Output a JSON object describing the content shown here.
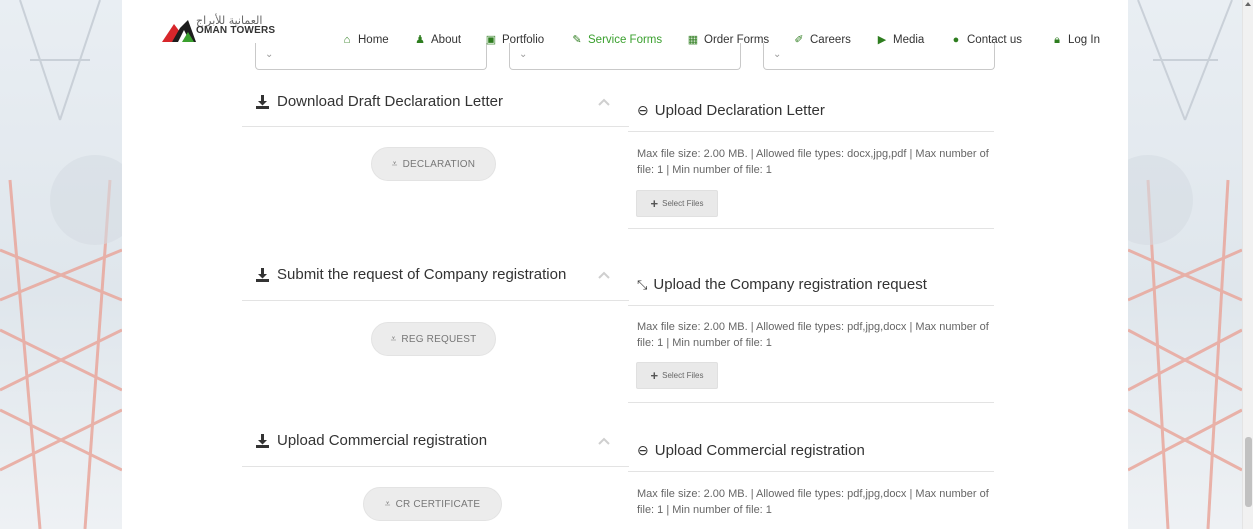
{
  "header": {
    "logo_ar": "العمانية للأبراج",
    "logo_en": "OMAN TOWERS",
    "nav": [
      {
        "label": "Home",
        "icon": "home-icon"
      },
      {
        "label": "About",
        "icon": "people-icon"
      },
      {
        "label": "Portfolio",
        "icon": "portfolio-icon"
      },
      {
        "label": "Service Forms",
        "icon": "pencil-icon",
        "active": true
      },
      {
        "label": "Order Forms",
        "icon": "grid-icon"
      },
      {
        "label": "Careers",
        "icon": "edit-icon"
      },
      {
        "label": "Media",
        "icon": "media-icon"
      },
      {
        "label": "Contact us",
        "icon": "chat-icon"
      },
      {
        "label": "Log In",
        "icon": "lock-icon"
      }
    ]
  },
  "sections": [
    {
      "download_title": "Download Draft Declaration Letter",
      "download_button": "DECLARATION",
      "upload_title": "Upload Declaration Letter",
      "upload_icon": "link-icon",
      "upload_info": "Max file size: 2.00 MB. | Allowed file types: docx,jpg,pdf | Max number of file: 1 | Min number of file: 1",
      "select_label": "Select Files"
    },
    {
      "download_title": "Submit the request of Company registration",
      "download_button": "REG REQUEST",
      "upload_title": "Upload the Company registration request",
      "upload_icon": "compress-icon",
      "upload_info": "Max file size: 2.00 MB. | Allowed file types: pdf,jpg,docx | Max number of file: 1 | Min number of file: 1",
      "select_label": "Select Files"
    },
    {
      "download_title": "Upload Commercial registration",
      "download_button": "CR CERTIFICATE",
      "upload_title": "Upload Commercial registration",
      "upload_icon": "link-icon",
      "upload_info": "Max file size: 2.00 MB. | Allowed file types: pdf,jpg,docx | Max number of file: 1 | Min number of file: 1"
    }
  ],
  "colors": {
    "accent_green": "#3aa02e",
    "icon_green": "#2e7d1f",
    "logo_red": "#d7262b"
  }
}
